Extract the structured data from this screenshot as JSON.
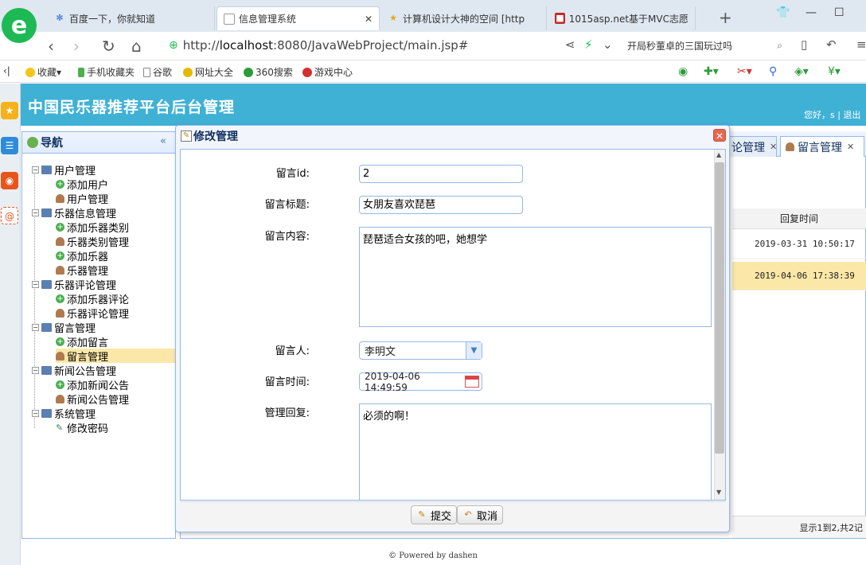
{
  "browser": {
    "tabs": [
      {
        "title": "百度一下，你就知道"
      },
      {
        "title": "信息管理系统",
        "active": true
      },
      {
        "title": "计算机设计大神的空间 [http"
      },
      {
        "title": "1015asp.net基于MVC志愿"
      }
    ],
    "url_prefix": "http://",
    "url_host": "localhost",
    "url_rest": ":8080/JavaWebProject/main.jsp#",
    "search_text": "开局秒董卓的三国玩过吗",
    "bookmarks": [
      "收藏",
      "手机收藏夹",
      "谷歌",
      "网址大全",
      "360搜索",
      "游戏中心"
    ]
  },
  "app": {
    "title": "中国民乐器推荐平台后台管理",
    "welcome": "您好，s  |  退出"
  },
  "nav": {
    "title": "导航",
    "tree": [
      {
        "label": "用户管理",
        "type": "folder"
      },
      {
        "label": "添加用户",
        "type": "add"
      },
      {
        "label": "用户管理",
        "type": "user"
      },
      {
        "label": "乐器信息管理",
        "type": "folder"
      },
      {
        "label": "添加乐器类别",
        "type": "add"
      },
      {
        "label": "乐器类别管理",
        "type": "user"
      },
      {
        "label": "添加乐器",
        "type": "add"
      },
      {
        "label": "乐器管理",
        "type": "user"
      },
      {
        "label": "乐器评论管理",
        "type": "folder"
      },
      {
        "label": "添加乐器评论",
        "type": "add"
      },
      {
        "label": "乐器评论管理",
        "type": "user"
      },
      {
        "label": "留言管理",
        "type": "folder"
      },
      {
        "label": "添加留言",
        "type": "add"
      },
      {
        "label": "留言管理",
        "type": "user",
        "selected": true
      },
      {
        "label": "新闻公告管理",
        "type": "folder"
      },
      {
        "label": "添加新闻公告",
        "type": "add"
      },
      {
        "label": "新闻公告管理",
        "type": "user"
      },
      {
        "label": "系统管理",
        "type": "folder"
      },
      {
        "label": "修改密码",
        "type": "pencil"
      }
    ]
  },
  "center_tabs": [
    {
      "label": "论管理"
    },
    {
      "label": "留言管理",
      "active": true
    }
  ],
  "grid": {
    "header": "回复时间",
    "rows": [
      "2019-03-31 10:50:17",
      "2019-04-06 17:38:39"
    ],
    "pager": "显示1到2,共2记"
  },
  "dialog": {
    "title": "修改管理",
    "fields": {
      "id_label": "留言id:",
      "id_value": "2",
      "title_label": "留言标题:",
      "title_value": "女朋友喜欢琵琶",
      "content_label": "留言内容:",
      "content_value": "琵琶适合女孩的吧，她想学",
      "person_label": "留言人:",
      "person_value": "李明文",
      "time_label": "留言时间:",
      "time_value": "2019-04-06 14:49:59",
      "reply_label": "管理回复:",
      "reply_value": "必须的啊！"
    },
    "submit": "提交",
    "cancel": "取消"
  },
  "footer": "© Powered by dashen",
  "colors": {
    "header_bg": "#3fb1d5",
    "border": "#95b8e7",
    "selected_row": "#fbe7a7"
  }
}
